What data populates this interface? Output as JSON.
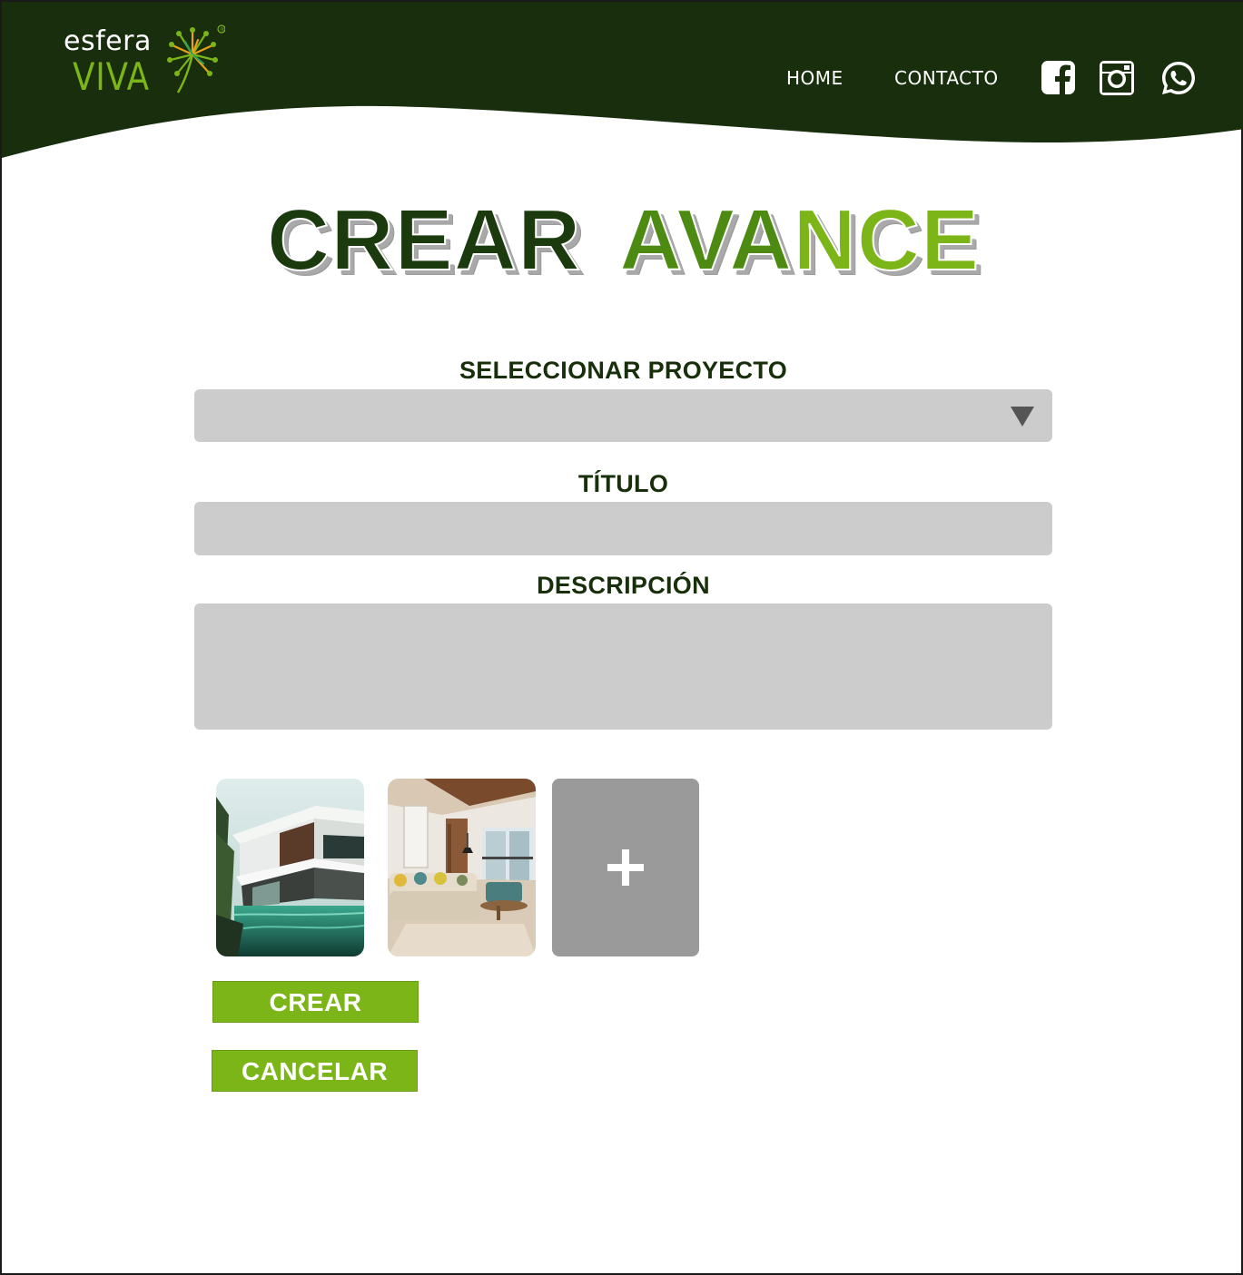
{
  "header": {
    "logo": {
      "line1": "esfera",
      "line2": "VIVA",
      "registered": "®"
    },
    "nav": [
      {
        "label": "HOME"
      },
      {
        "label": "CONTACTO"
      }
    ],
    "social": [
      {
        "icon": "facebook-icon"
      },
      {
        "icon": "instagram-icon"
      },
      {
        "icon": "whatsapp-icon"
      }
    ]
  },
  "title": {
    "word1": "CREAR",
    "word2a": "AVA",
    "word2b": "NCE"
  },
  "form": {
    "proyecto": {
      "label": "SELECCIONAR PROYECTO",
      "value": ""
    },
    "titulo": {
      "label": "TÍTULO",
      "value": ""
    },
    "descripcion": {
      "label": "DESCRIPCIÓN",
      "value": ""
    }
  },
  "images": {
    "thumbnails": [
      {
        "subject": "modern house with pool"
      },
      {
        "subject": "living room interior"
      }
    ],
    "add_symbol": "+"
  },
  "buttons": {
    "create": "CREAR",
    "cancel": "CANCELAR"
  },
  "colors": {
    "header_bg": "#182e0c",
    "accent": "#7cb518",
    "field_bg": "#cccccc",
    "label_text": "#17300b"
  }
}
